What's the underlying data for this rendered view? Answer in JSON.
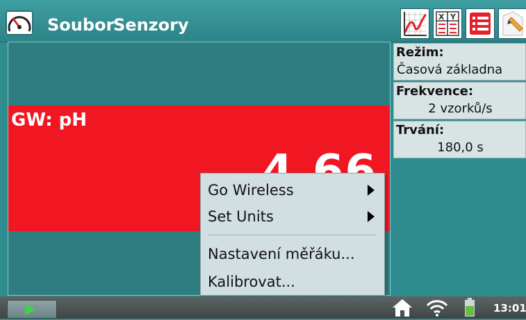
{
  "header": {
    "menu": [
      {
        "label": "Soubor"
      },
      {
        "label": "Senzory"
      }
    ],
    "tools": [
      {
        "icon": "graph-view-icon"
      },
      {
        "icon": "table-view-icon"
      },
      {
        "icon": "meter-view-icon"
      },
      {
        "icon": "notes-icon"
      }
    ]
  },
  "meter": {
    "sensor_label": "GW: pH",
    "value": "4.66",
    "colors": {
      "value_panel": "#f01722",
      "background": "#2e7d80"
    }
  },
  "settings": {
    "mode": {
      "label": "Režim:",
      "value": "Časová základna"
    },
    "rate": {
      "label": "Frekvence:",
      "value": "2 vzorků/s"
    },
    "duration": {
      "label": "Trvání:",
      "value": "180,0 s"
    }
  },
  "context_menu": {
    "items": [
      {
        "label": "Go Wireless",
        "submenu": true
      },
      {
        "label": "Set Units",
        "submenu": true
      },
      {
        "label": "Nastavení měřáku...",
        "submenu": false
      },
      {
        "label": "Kalibrovat...",
        "submenu": false
      }
    ]
  },
  "status_bar": {
    "play_icon": "play-icon",
    "icons": [
      "home-icon",
      "wifi-icon",
      "battery-icon"
    ],
    "time": "13:01"
  }
}
